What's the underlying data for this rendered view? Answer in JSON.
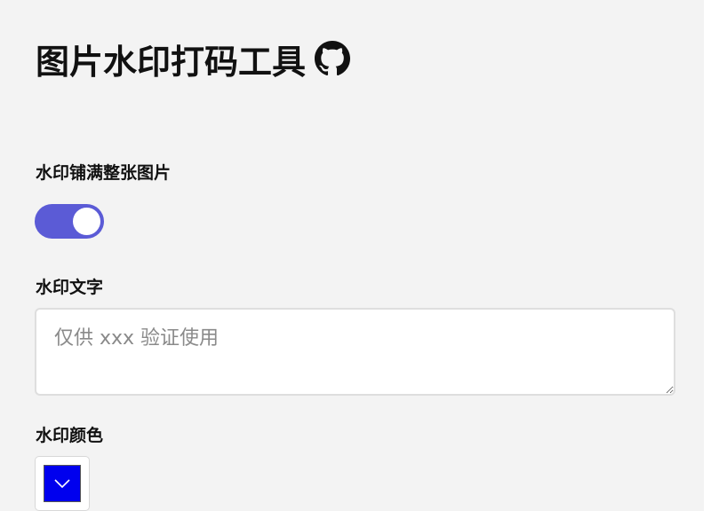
{
  "header": {
    "title": "图片水印打码工具",
    "github_icon": "github-icon"
  },
  "form": {
    "fill_label": "水印铺满整张图片",
    "fill_enabled": true,
    "text_label": "水印文字",
    "text_placeholder": "仅供 xxx 验证使用",
    "text_value": "",
    "color_label": "水印颜色",
    "color_value": "#0000ee",
    "color_icon": "chevron-down-icon"
  },
  "colors": {
    "background": "#f3f3f3",
    "toggle_on": "#5b5bd6",
    "swatch": "#0000ee"
  }
}
